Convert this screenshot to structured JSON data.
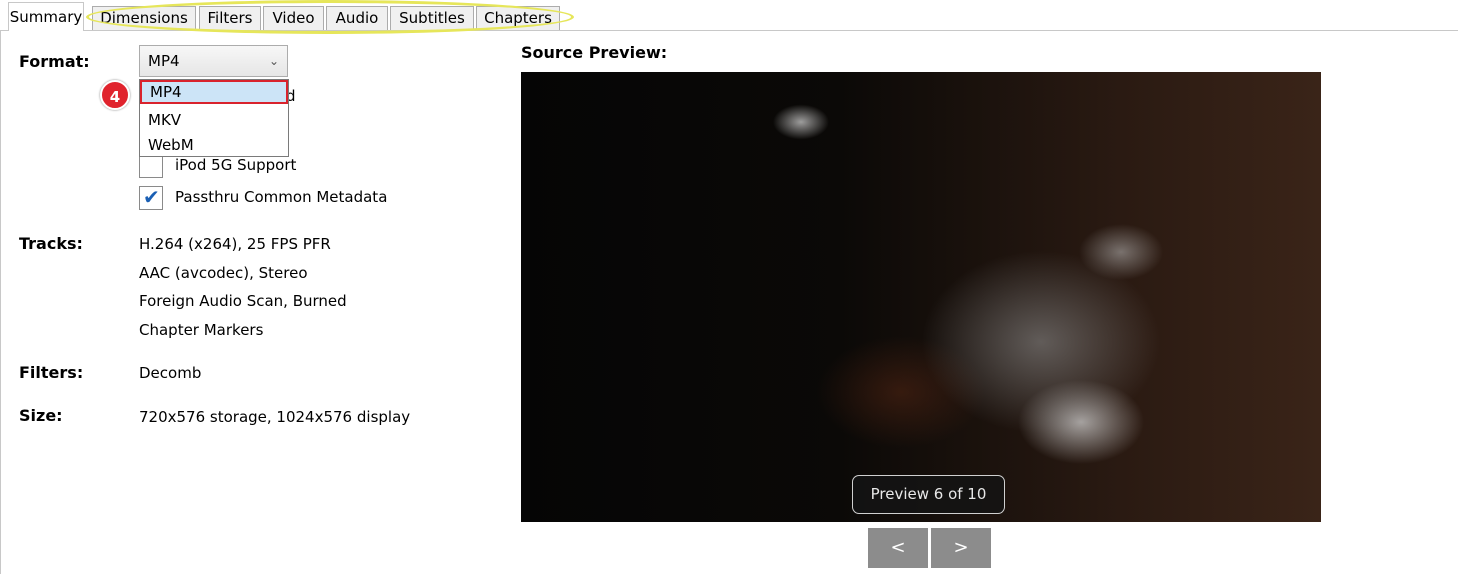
{
  "tabs": [
    {
      "label": "Summary",
      "active": true
    },
    {
      "label": "Dimensions"
    },
    {
      "label": "Filters"
    },
    {
      "label": "Video"
    },
    {
      "label": "Audio"
    },
    {
      "label": "Subtitles"
    },
    {
      "label": "Chapters"
    }
  ],
  "format": {
    "label": "Format:",
    "selected": "MP4",
    "options": [
      "MP4",
      "MKV",
      "WebM"
    ],
    "badge": "4"
  },
  "options": {
    "web_optimized_partial": "d",
    "ipod_label": "iPod 5G Support",
    "ipod_checked": false,
    "passthru_label": "Passthru Common Metadata",
    "passthru_checked": true
  },
  "tracks": {
    "label": "Tracks:",
    "items": [
      "H.264 (x264), 25 FPS PFR",
      "AAC (avcodec), Stereo",
      "Foreign Audio Scan, Burned",
      "Chapter Markers"
    ]
  },
  "filters": {
    "label": "Filters:",
    "value": "Decomb"
  },
  "size": {
    "label": "Size:",
    "value": "720x576 storage, 1024x576 display"
  },
  "preview": {
    "title": "Source Preview:",
    "counter": "Preview 6 of 10",
    "prev_label": "<",
    "next_label": ">"
  }
}
